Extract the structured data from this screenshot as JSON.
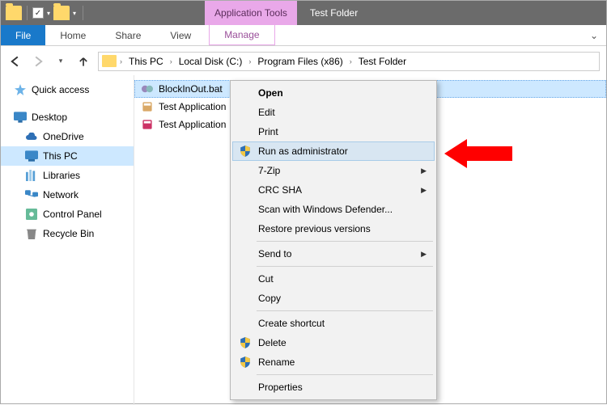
{
  "titlebar": {
    "context_tab": "Application Tools",
    "window_title": "Test Folder"
  },
  "ribbon": {
    "file": "File",
    "home": "Home",
    "share": "Share",
    "view": "View",
    "manage": "Manage"
  },
  "breadcrumb": {
    "items": [
      "This PC",
      "Local Disk (C:)",
      "Program Files (x86)",
      "Test Folder"
    ]
  },
  "tree": {
    "quick_access": "Quick access",
    "desktop": "Desktop",
    "onedrive": "OneDrive",
    "this_pc": "This PC",
    "libraries": "Libraries",
    "network": "Network",
    "control_panel": "Control Panel",
    "recycle_bin": "Recycle Bin"
  },
  "files": {
    "items": [
      "BlockInOut.bat",
      "Test Application",
      "Test Application"
    ]
  },
  "context_menu": {
    "open": "Open",
    "edit": "Edit",
    "print": "Print",
    "run_as_admin": "Run as administrator",
    "seven_zip": "7-Zip",
    "crc_sha": "CRC SHA",
    "scan_defender": "Scan with Windows Defender...",
    "restore_prev": "Restore previous versions",
    "send_to": "Send to",
    "cut": "Cut",
    "copy": "Copy",
    "create_shortcut": "Create shortcut",
    "delete": "Delete",
    "rename": "Rename",
    "properties": "Properties"
  }
}
